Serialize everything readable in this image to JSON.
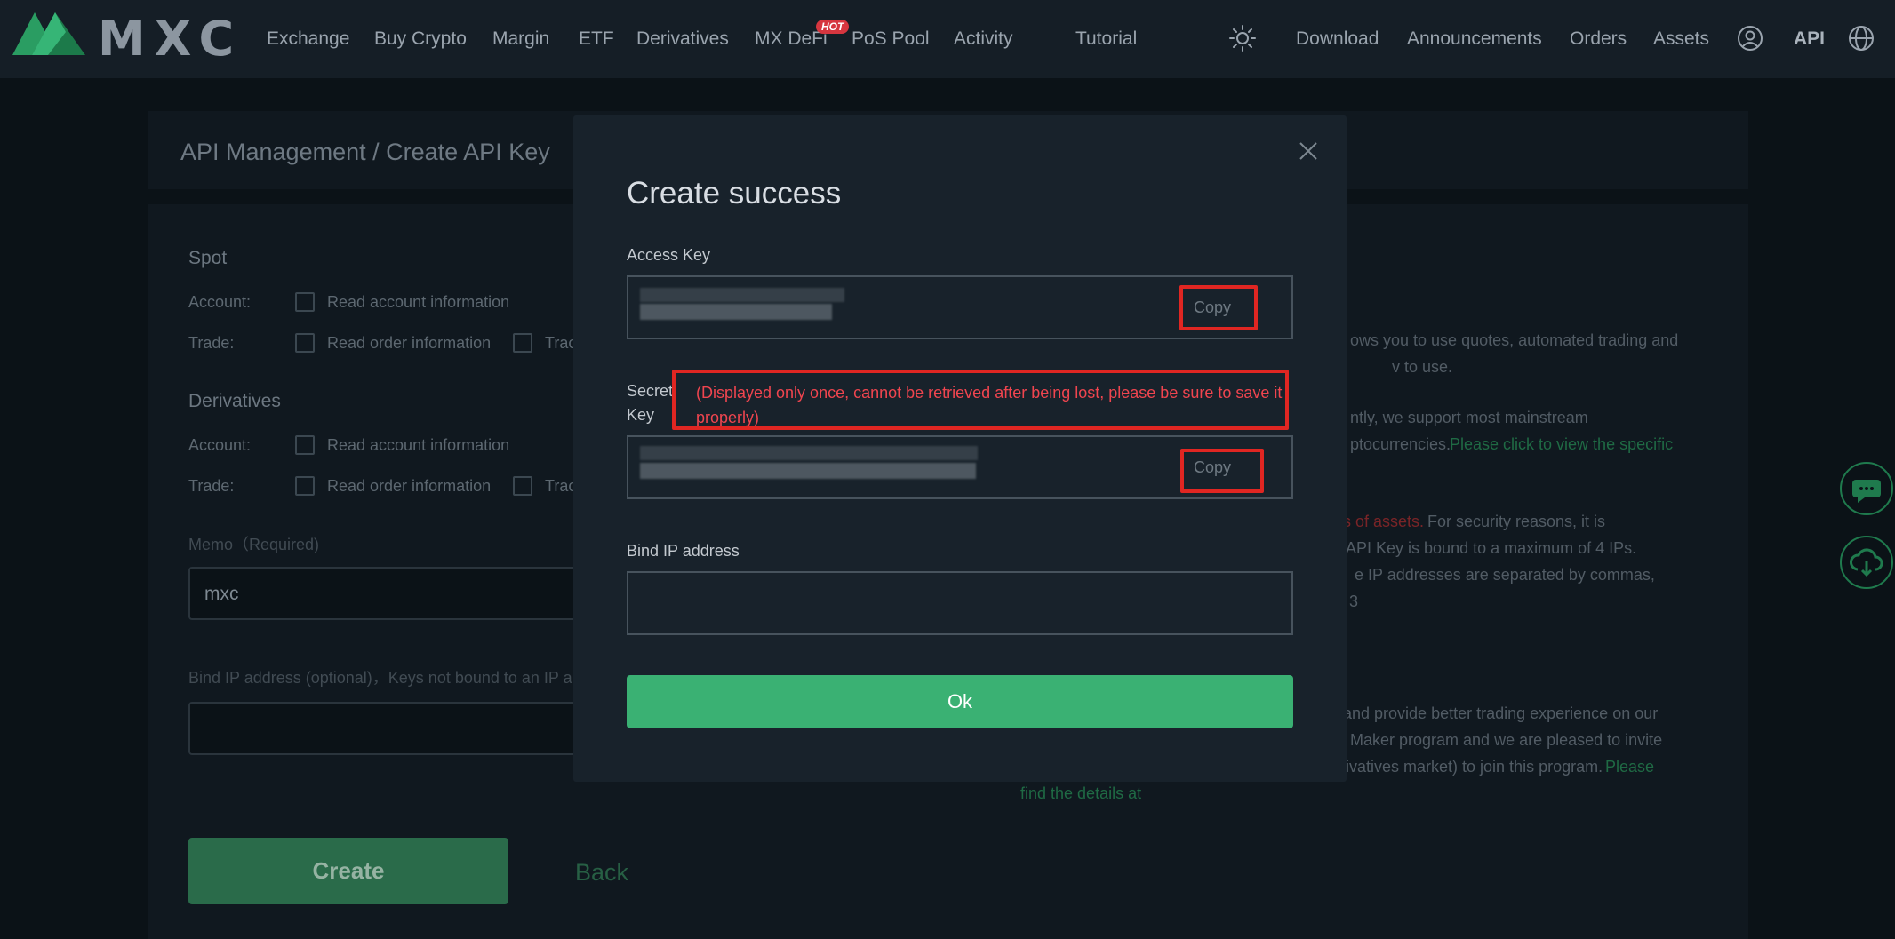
{
  "nav": {
    "brand": "MXC",
    "items": [
      "Exchange",
      "Buy Crypto",
      "Margin",
      "ETF",
      "Derivatives",
      "MX DeFi",
      "PoS Pool",
      "Activity",
      "Tutorial"
    ],
    "hot_badge": "HOT",
    "right_items": [
      "Download",
      "Announcements",
      "Orders",
      "Assets"
    ],
    "api_label": "API",
    "icons": [
      "sun-icon",
      "user-icon",
      "globe-icon"
    ]
  },
  "page": {
    "breadcrumb": "API Management / Create API Key",
    "spot_heading": "Spot",
    "derivatives_heading": "Derivatives",
    "account_label": "Account:",
    "trade_label": "Trade:",
    "read_account": "Read account information",
    "read_order": "Read order information",
    "trade_truncated": "Trac",
    "memo_label": "Memo（Required)",
    "memo_value": "mxc",
    "bind_ip_optional": "Bind IP address (optional)，Keys not bound to an IP a",
    "create_button": "Create",
    "back_link": "Back",
    "right_lines": [
      "ows you to use quotes, automated trading and",
      "v to use.",
      "ntly, we support most mainstream",
      "ptocurrencies.",
      "Please click to view the specific",
      "s of assets.",
      "For security reasons, it is",
      "API Key is bound to a maximum of 4 IPs.",
      "e IP addresses are separated by commas,",
      "3",
      "and provide better trading experience on our",
      "Maker program and we are pleased to invite",
      "ivatives market) to join this program.",
      "Please",
      "find the details at"
    ]
  },
  "modal": {
    "title": "Create success",
    "access_key_label": "Access Key",
    "copy_label": "Copy",
    "secret_key_label_1": "Secret",
    "secret_key_label_2": "Key",
    "warning": "(Displayed only once, cannot be retrieved after being lost, please be sure to save it properly)",
    "bind_ip_label": "Bind IP address",
    "ok_button": "Ok"
  },
  "colors": {
    "accent_green": "#3ab173",
    "highlight_red": "#e02622",
    "warning_text": "#f0454f"
  }
}
